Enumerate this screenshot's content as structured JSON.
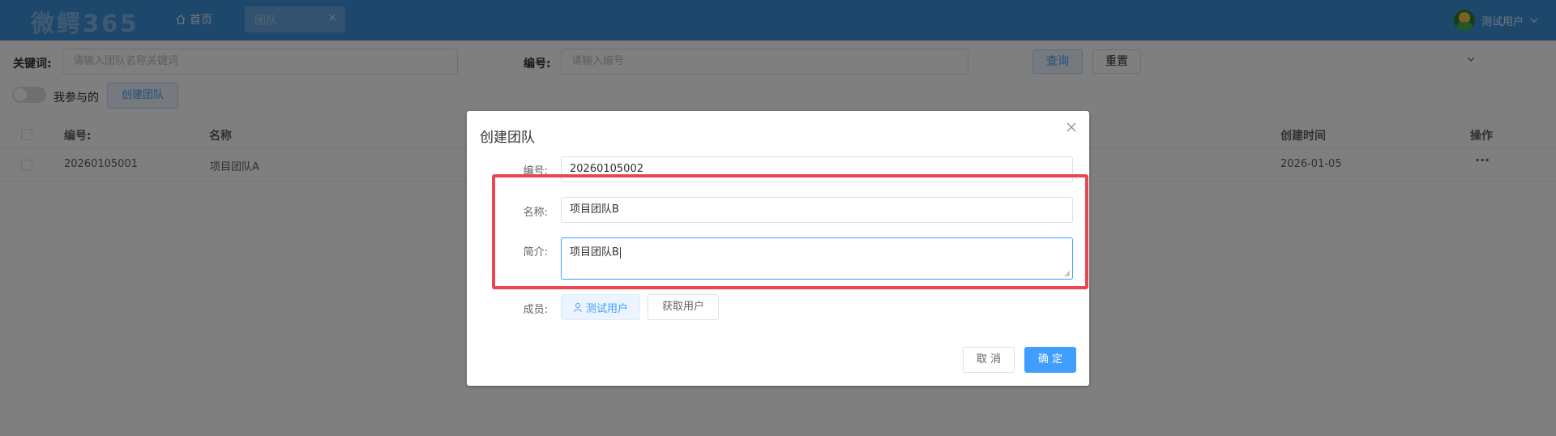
{
  "header": {
    "logo": "微鳄365",
    "home_label": "首页",
    "tab_label": "团队",
    "tab_close": "×",
    "user_name": "测试用户"
  },
  "filters": {
    "keyword_label": "关键词:",
    "keyword_placeholder": "请输入团队名称关键词",
    "number_label": "编号:",
    "number_placeholder": "请输入编号",
    "query_button": "查询",
    "reset_button": "重置",
    "participate_label": "我参与的",
    "create_button": "创建团队"
  },
  "table": {
    "columns": [
      "编号:",
      "名称",
      "创建时间",
      "操作"
    ],
    "rows": [
      {
        "number": "20260105001",
        "name": "项目团队A",
        "created": "2026-01-05",
        "action": "···"
      }
    ]
  },
  "dialog": {
    "title": "创建团队",
    "number_label": "编号:",
    "number_value": "20260105002",
    "name_label": "名称:",
    "name_value": "项目团队B",
    "intro_label": "简介:",
    "intro_value": "项目团队B",
    "members_label": "成员:",
    "member_tag": "测试用户",
    "fetch_users_button": "获取用户",
    "cancel_button": "取 消",
    "confirm_button": "确 定"
  },
  "colors": {
    "header_bg": "#3d8fd8",
    "primary": "#409eff",
    "highlight": "#e9474f"
  }
}
